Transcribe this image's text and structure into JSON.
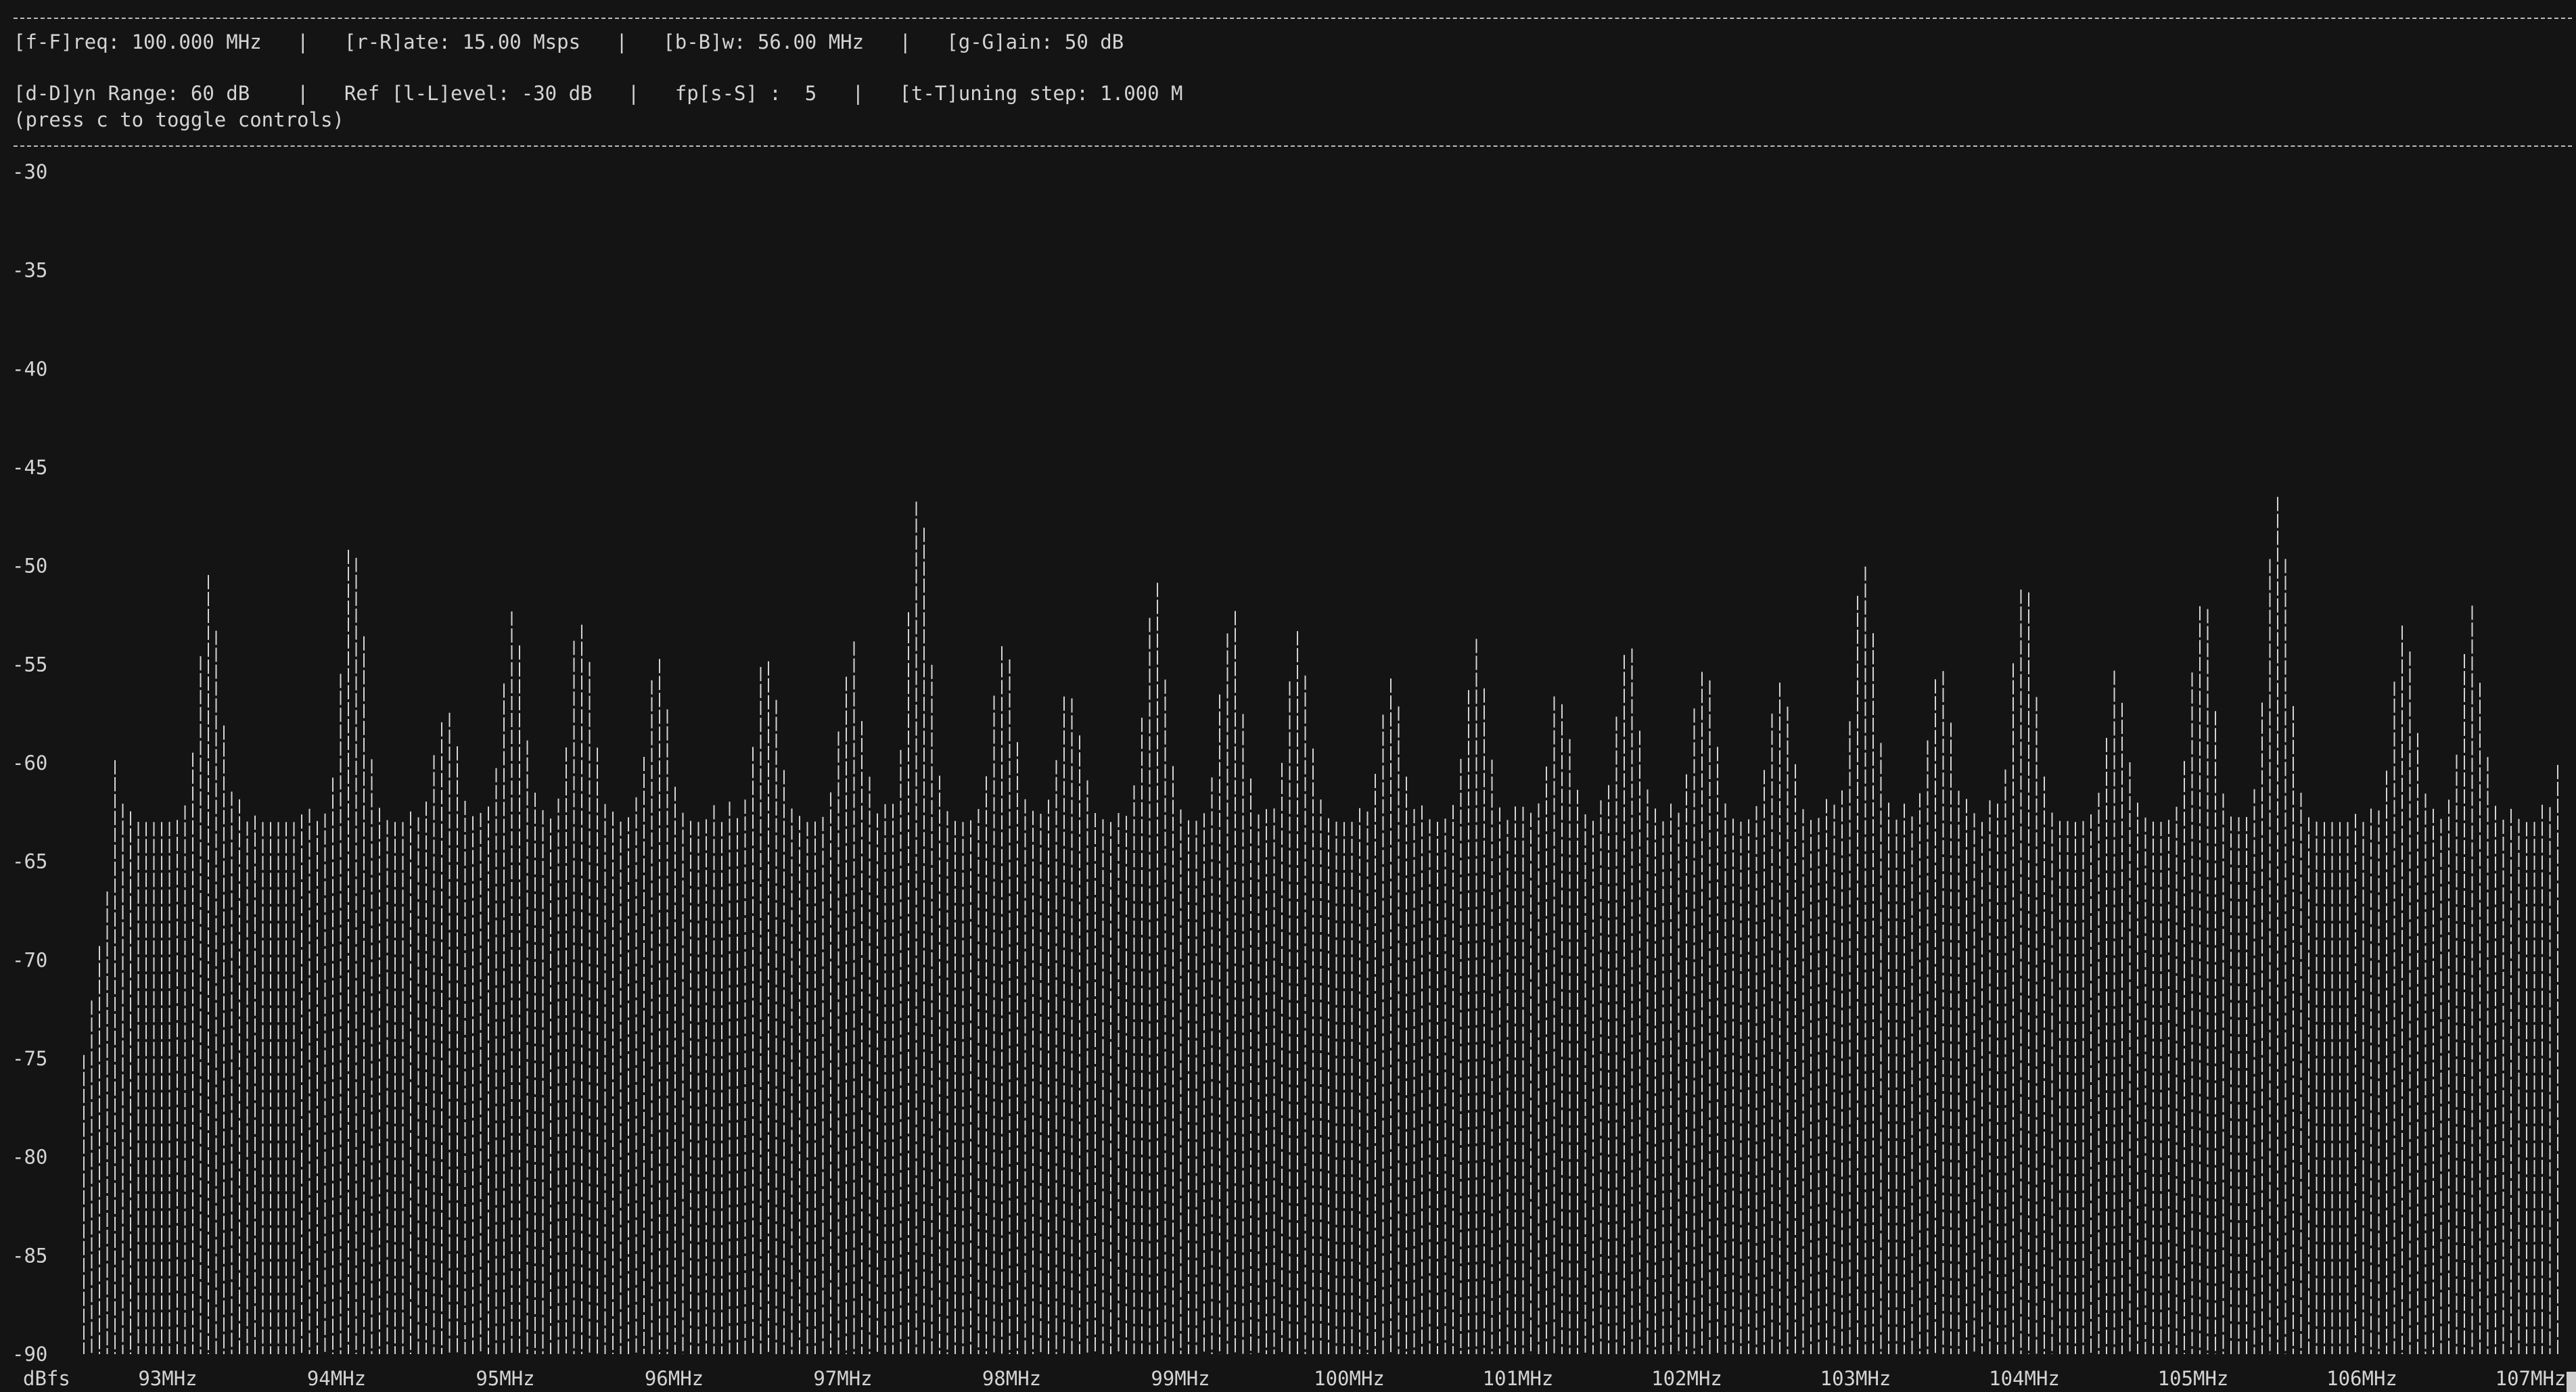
{
  "controls": {
    "line1": "[f-F]req: 100.000 MHz   |   [r-R]ate: 15.00 Msps   |   [b-B]w: 56.00 MHz   |   [g-G]ain: 50 dB",
    "line2": "[d-D]yn Range: 60 dB    |   Ref [l-L]evel: -30 dB   |   fp[s-S] :  5   |   [t-T]uning step: 1.000 M",
    "line3": "(press c to toggle controls)"
  },
  "chart_data": {
    "type": "bar",
    "ylabel": "dBfs",
    "ylim": [
      -90,
      -30
    ],
    "y_ticks": [
      "-30",
      "-35",
      "-40",
      "-45",
      "-50",
      "-55",
      "-60",
      "-65",
      "-70",
      "-75",
      "-80",
      "-85",
      "-90"
    ],
    "x_ticks": [
      "93MHz",
      "94MHz",
      "95MHz",
      "96MHz",
      "97MHz",
      "98MHz",
      "99MHz",
      "100MHz",
      "101MHz",
      "102MHz",
      "103MHz",
      "104MHz",
      "105MHz",
      "106MHz",
      "107MHz"
    ],
    "freq_range_mhz": [
      92.5,
      107.5
    ],
    "noise_floor_dbfs": -63,
    "peaks": [
      {
        "freq_mhz": 92.6,
        "dbfs": -55
      },
      {
        "freq_mhz": 93.25,
        "dbfs": -51
      },
      {
        "freq_mhz": 94.1,
        "dbfs": -48.5
      },
      {
        "freq_mhz": 94.65,
        "dbfs": -57
      },
      {
        "freq_mhz": 95.05,
        "dbfs": -53
      },
      {
        "freq_mhz": 95.45,
        "dbfs": -52
      },
      {
        "freq_mhz": 95.9,
        "dbfs": -55
      },
      {
        "freq_mhz": 96.55,
        "dbfs": -54
      },
      {
        "freq_mhz": 97.05,
        "dbfs": -54
      },
      {
        "freq_mhz": 97.45,
        "dbfs": -47
      },
      {
        "freq_mhz": 97.95,
        "dbfs": -54
      },
      {
        "freq_mhz": 98.35,
        "dbfs": -56
      },
      {
        "freq_mhz": 98.85,
        "dbfs": -51
      },
      {
        "freq_mhz": 99.3,
        "dbfs": -52
      },
      {
        "freq_mhz": 99.7,
        "dbfs": -53
      },
      {
        "freq_mhz": 100.25,
        "dbfs": -56
      },
      {
        "freq_mhz": 100.75,
        "dbfs": -54
      },
      {
        "freq_mhz": 101.25,
        "dbfs": -56
      },
      {
        "freq_mhz": 101.65,
        "dbfs": -54
      },
      {
        "freq_mhz": 102.1,
        "dbfs": -55
      },
      {
        "freq_mhz": 102.55,
        "dbfs": -55
      },
      {
        "freq_mhz": 103.05,
        "dbfs": -50
      },
      {
        "freq_mhz": 103.5,
        "dbfs": -55
      },
      {
        "freq_mhz": 104.0,
        "dbfs": -50
      },
      {
        "freq_mhz": 104.55,
        "dbfs": -56
      },
      {
        "freq_mhz": 105.05,
        "dbfs": -51
      },
      {
        "freq_mhz": 105.5,
        "dbfs": -46
      },
      {
        "freq_mhz": 106.25,
        "dbfs": -53
      },
      {
        "freq_mhz": 106.65,
        "dbfs": -53
      },
      {
        "freq_mhz": 107.25,
        "dbfs": -56
      }
    ]
  }
}
